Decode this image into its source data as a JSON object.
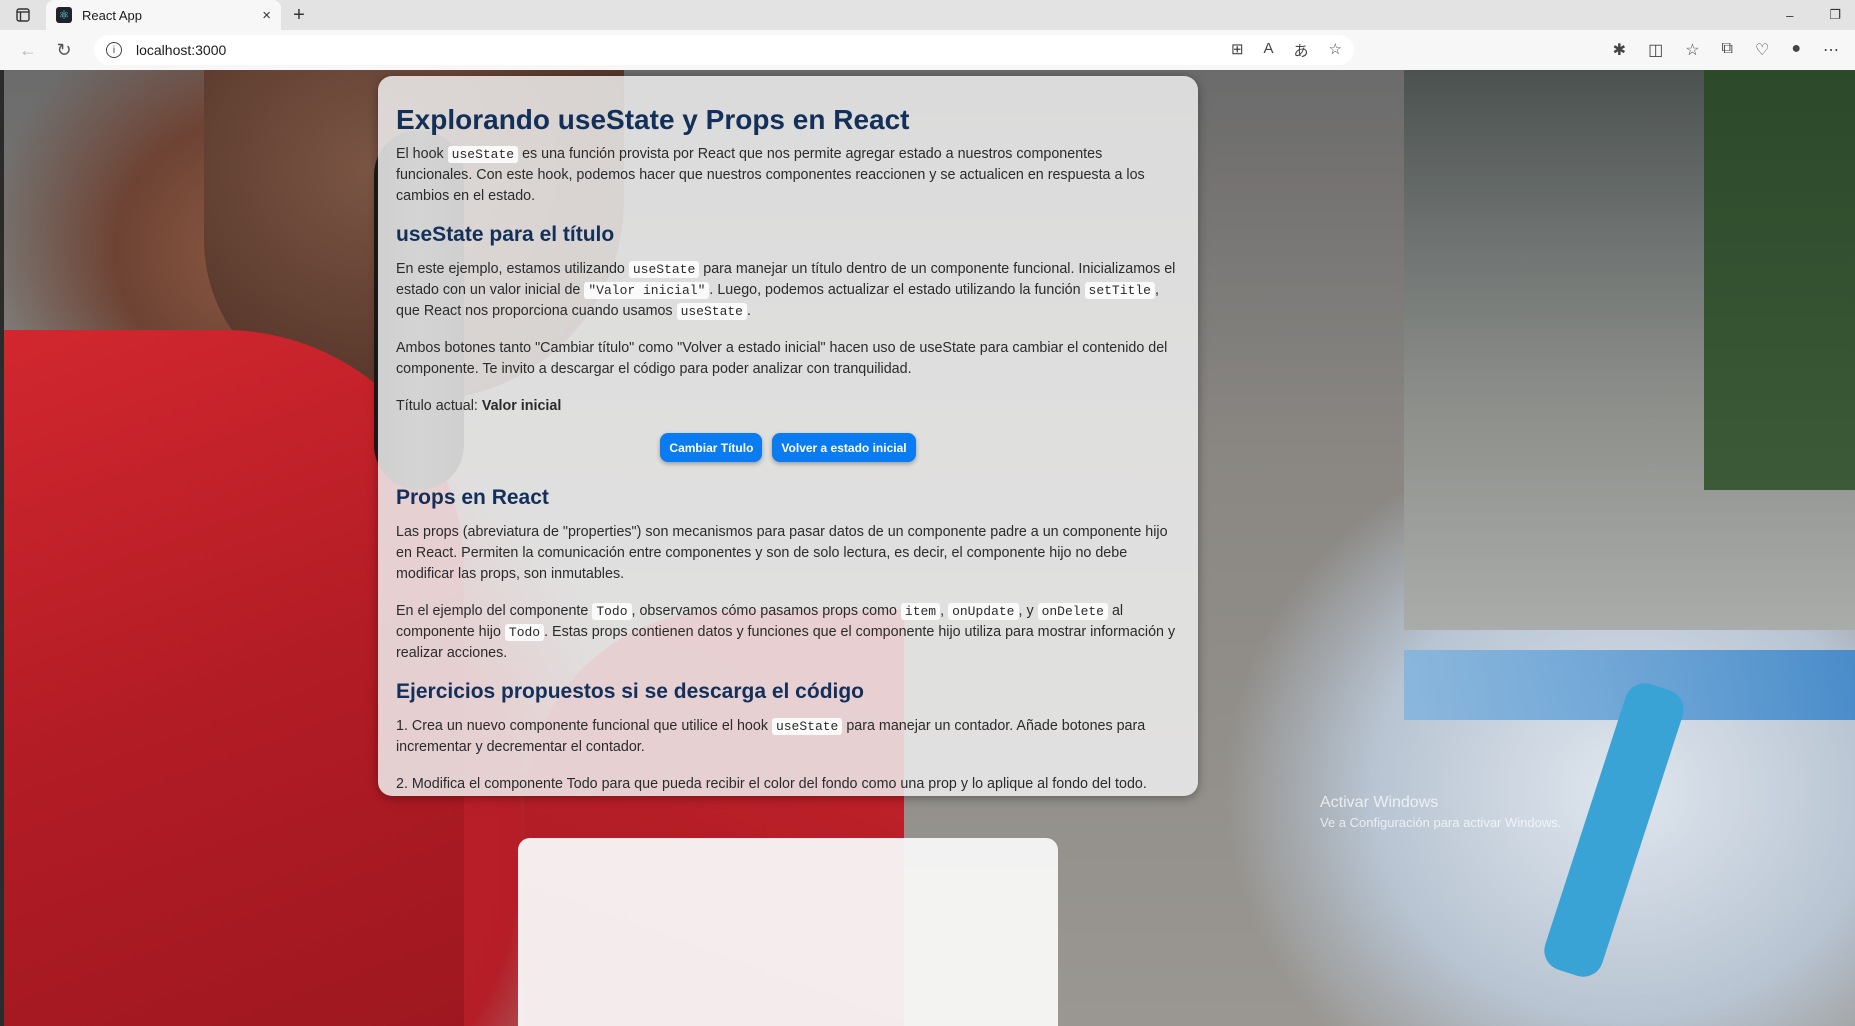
{
  "browser": {
    "tab_title": "React App",
    "tab_close": "×",
    "new_tab": "+",
    "address": "localhost:3000",
    "win_minimize": "–",
    "win_restore": "❐"
  },
  "page": {
    "title": "Explorando useState y Props en React",
    "intro": {
      "a": "El hook ",
      "code1": "useState",
      "b": " es una función provista por React que nos permite agregar estado a nuestros componentes funcionales. Con este hook, podemos hacer que nuestros componentes reaccionen y se actualicen en respuesta a los cambios en el estado."
    },
    "section_title": {
      "heading": "useState para el título",
      "p1": {
        "a": "En este ejemplo, estamos utilizando ",
        "code1": "useState",
        "b": " para manejar un título dentro de un componente funcional. Inicializamos el estado con un valor inicial de ",
        "code2": "\"Valor inicial\"",
        "c": ". Luego, podemos actualizar el estado utilizando la función ",
        "code3": "setTitle",
        "d": ", que React nos proporciona cuando usamos ",
        "code4": "useState",
        "e": "."
      },
      "p2": "Ambos botones tanto \"Cambiar título\" como \"Volver a estado inicial\" hacen uso de useState para cambiar el contenido del componente. Te invito a descargar el código para poder analizar con tranquilidad.",
      "current_label": "Título actual: ",
      "current_value": "Valor inicial",
      "btn_change": "Cambiar Título",
      "btn_reset": "Volver a estado inicial"
    },
    "section_props": {
      "heading": "Props en React",
      "p1": "Las props (abreviatura de \"properties\") son mecanismos para pasar datos de un componente padre a un componente hijo en React. Permiten la comunicación entre componentes y son de solo lectura, es decir, el componente hijo no debe modificar las props, son inmutables.",
      "p2": {
        "a": "En el ejemplo del componente ",
        "code1": "Todo",
        "b": ", observamos cómo pasamos props como ",
        "code2": "item",
        "c": ", ",
        "code3": "onUpdate",
        "d": ", y ",
        "code4": "onDelete",
        "e": " al componente hijo ",
        "code5": "Todo",
        "f": ". Estas props contienen datos y funciones que el componente hijo utiliza para mostrar información y realizar acciones."
      }
    },
    "section_exercises": {
      "heading": "Ejercicios propuestos si se descarga el código",
      "e1": {
        "a": "1. Crea un nuevo componente funcional que utilice el hook ",
        "code1": "useState",
        "b": " para manejar un contador. Añade botones para incrementar y decrementar el contador."
      },
      "e2": "2. Modifica el componente Todo para que pueda recibir el color del fondo como una prop y lo aplique al fondo del todo."
    }
  },
  "watermark": {
    "line1": "Activar Windows",
    "line2": "Ve a Configuración para activar Windows."
  }
}
